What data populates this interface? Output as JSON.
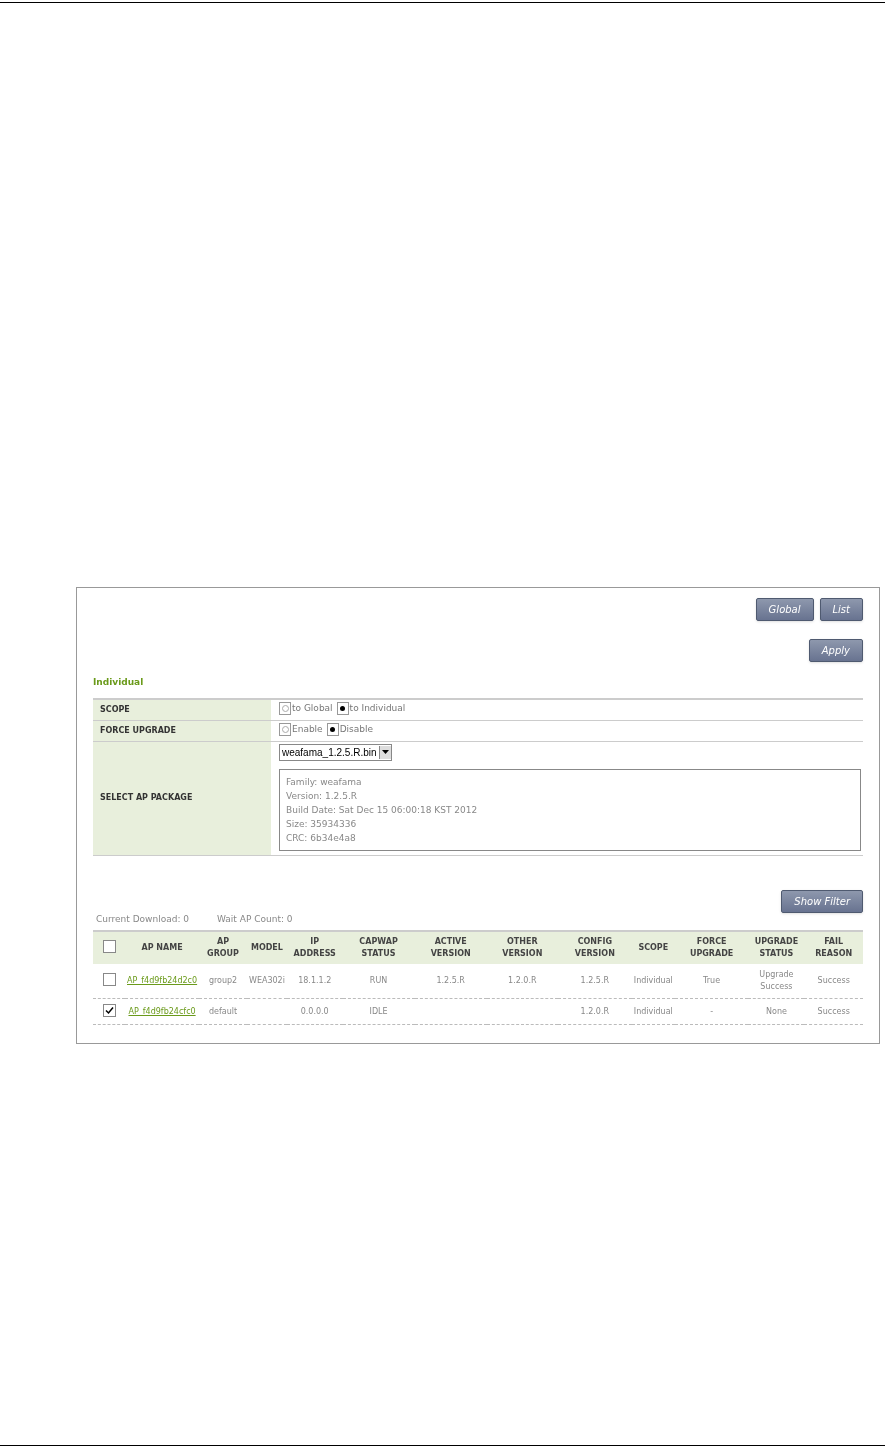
{
  "top_buttons": [
    {
      "label": "Global"
    },
    {
      "label": "List"
    }
  ],
  "apply_button": {
    "label": "Apply"
  },
  "section_title": "Individual",
  "form_rows": [
    {
      "kind": "radio",
      "label": "SCOPE",
      "options": [
        {
          "label": "to Global",
          "selected": false
        },
        {
          "label": "to Individual",
          "selected": true
        }
      ]
    },
    {
      "kind": "radio",
      "label": "FORCE UPGRADE",
      "options": [
        {
          "label": "Enable",
          "selected": false
        },
        {
          "label": "Disable",
          "selected": true
        }
      ]
    },
    {
      "kind": "package",
      "label": "SELECT AP PACKAGE",
      "value": "weafama_1.2.5.R.bin",
      "details": [
        "Family: weafama",
        "Version: 1.2.5.R",
        "Build Date: Sat Dec 15 06:00:18 KST 2012",
        "Size: 35934336",
        "CRC: 6b34e4a8"
      ]
    }
  ],
  "filter_button": {
    "label": "Show Filter"
  },
  "stats": [
    "Current Download: 0",
    "Wait AP Count: 0"
  ],
  "table": {
    "select_all_checked": false,
    "columns": [
      "AP NAME",
      "AP GROUP",
      "MODEL",
      "IP ADDRESS",
      "CAPWAP STATUS",
      "ACTIVE VERSION",
      "OTHER VERSION",
      "CONFIG VERSION",
      "SCOPE",
      "FORCE UPGRADE",
      "UPGRADE STATUS",
      "FAIL REASON"
    ],
    "rows": [
      {
        "checked": false,
        "cells": [
          "AP_f4d9fb24d2c0",
          "group2",
          "WEA302i",
          "18.1.1.2",
          "RUN",
          "1.2.5.R",
          "1.2.0.R",
          "1.2.5.R",
          "Individual",
          "True",
          "Upgrade Success",
          "Success"
        ]
      },
      {
        "checked": true,
        "cells": [
          "AP_f4d9fb24cfc0",
          "default",
          "",
          "0.0.0.0",
          "IDLE",
          "",
          "",
          "1.2.0.R",
          "Individual",
          "-",
          "None",
          "Success"
        ]
      }
    ]
  }
}
